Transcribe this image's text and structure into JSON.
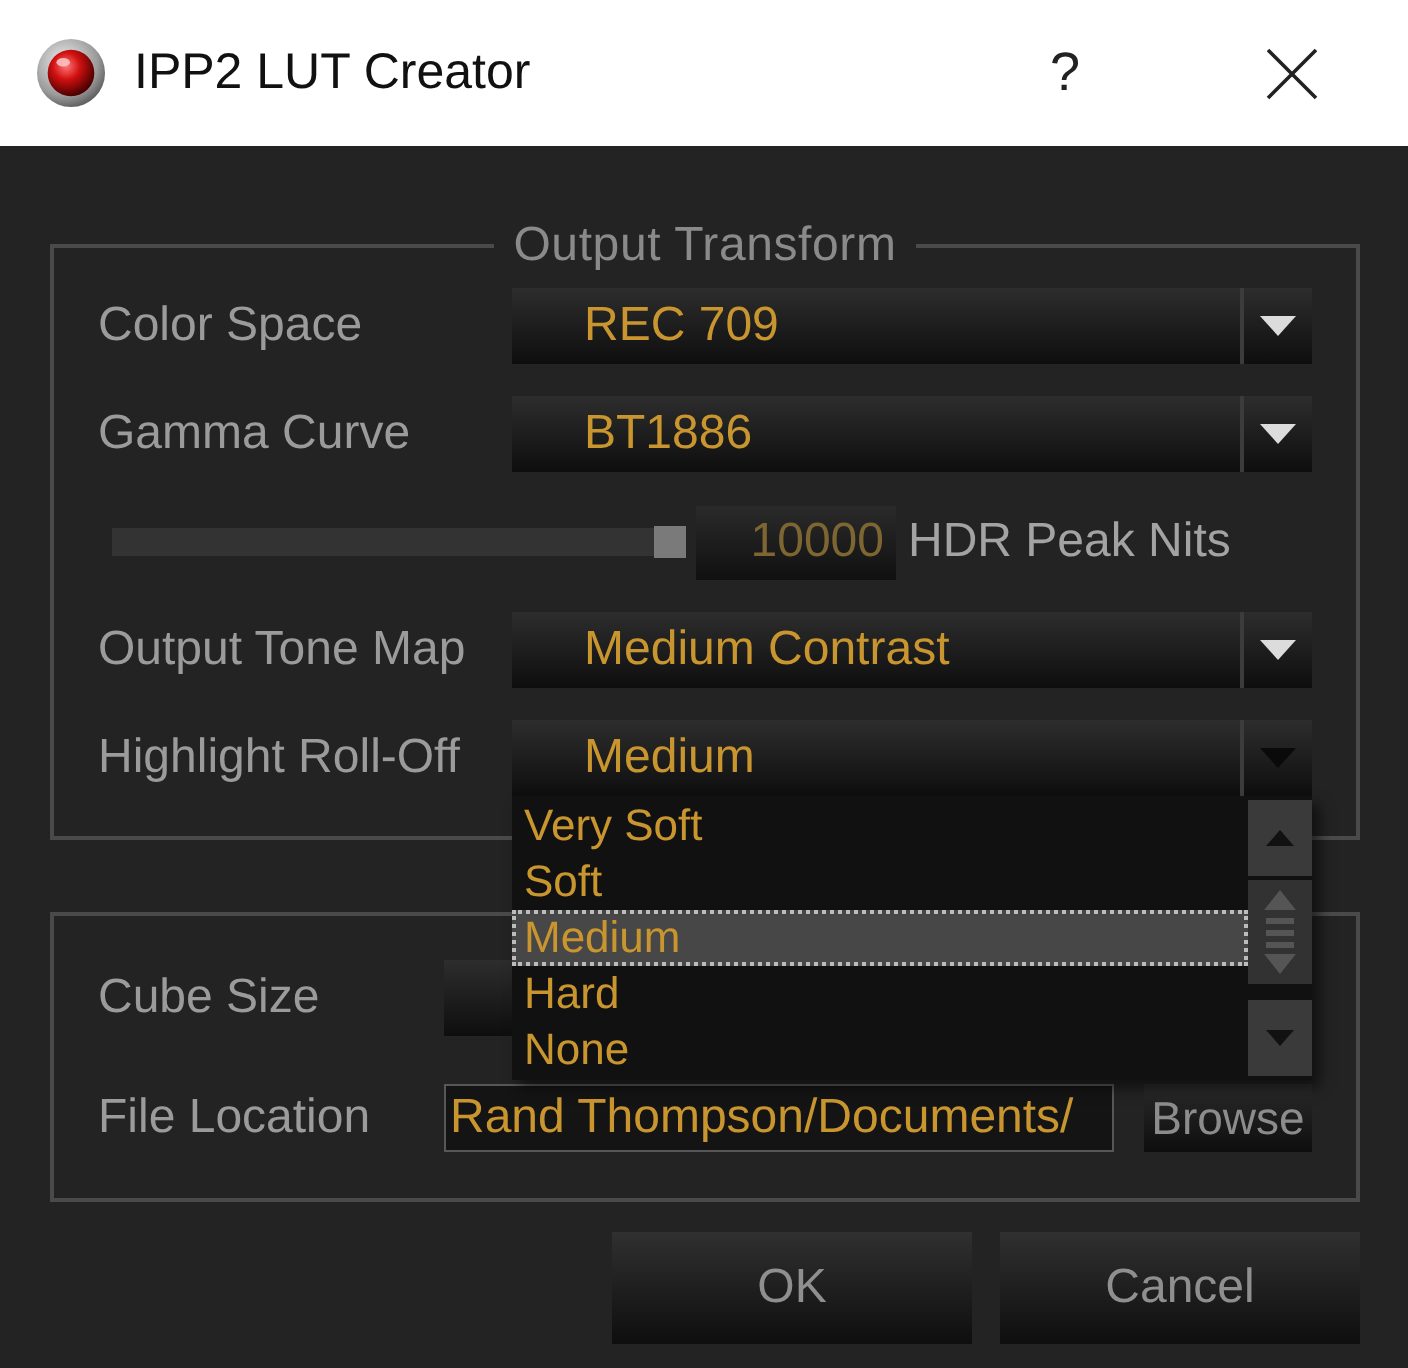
{
  "window": {
    "title": "IPP2 LUT Creator",
    "help_button": "?"
  },
  "output_transform": {
    "title": "Output Transform",
    "rows": [
      {
        "kind": "combo",
        "label": "Color Space",
        "value": "REC 709",
        "expanded": false
      },
      {
        "kind": "combo",
        "label": "Gamma Curve",
        "value": "BT1886",
        "expanded": false
      },
      {
        "kind": "slider",
        "level": 1,
        "value": "10000",
        "label": "HDR Peak Nits"
      },
      {
        "kind": "combo",
        "label": "Output Tone Map",
        "value": "Medium Contrast",
        "expanded": false
      },
      {
        "kind": "combo",
        "label": "Highlight Roll-Off",
        "value": "Medium",
        "expanded": true,
        "options": [
          {
            "label": "Very Soft",
            "selected": false
          },
          {
            "label": "Soft",
            "selected": false
          },
          {
            "label": "Medium",
            "selected": true
          },
          {
            "label": "Hard",
            "selected": false
          },
          {
            "label": "None",
            "selected": false
          }
        ]
      }
    ]
  },
  "export": {
    "rows": [
      {
        "kind": "combo",
        "label": "Cube Size"
      },
      {
        "kind": "path",
        "label": "File Location",
        "value": "Rand Thompson/Documents/",
        "button": "Browse"
      }
    ]
  },
  "buttons": [
    {
      "label": "OK"
    },
    {
      "label": "Cancel"
    }
  ]
}
